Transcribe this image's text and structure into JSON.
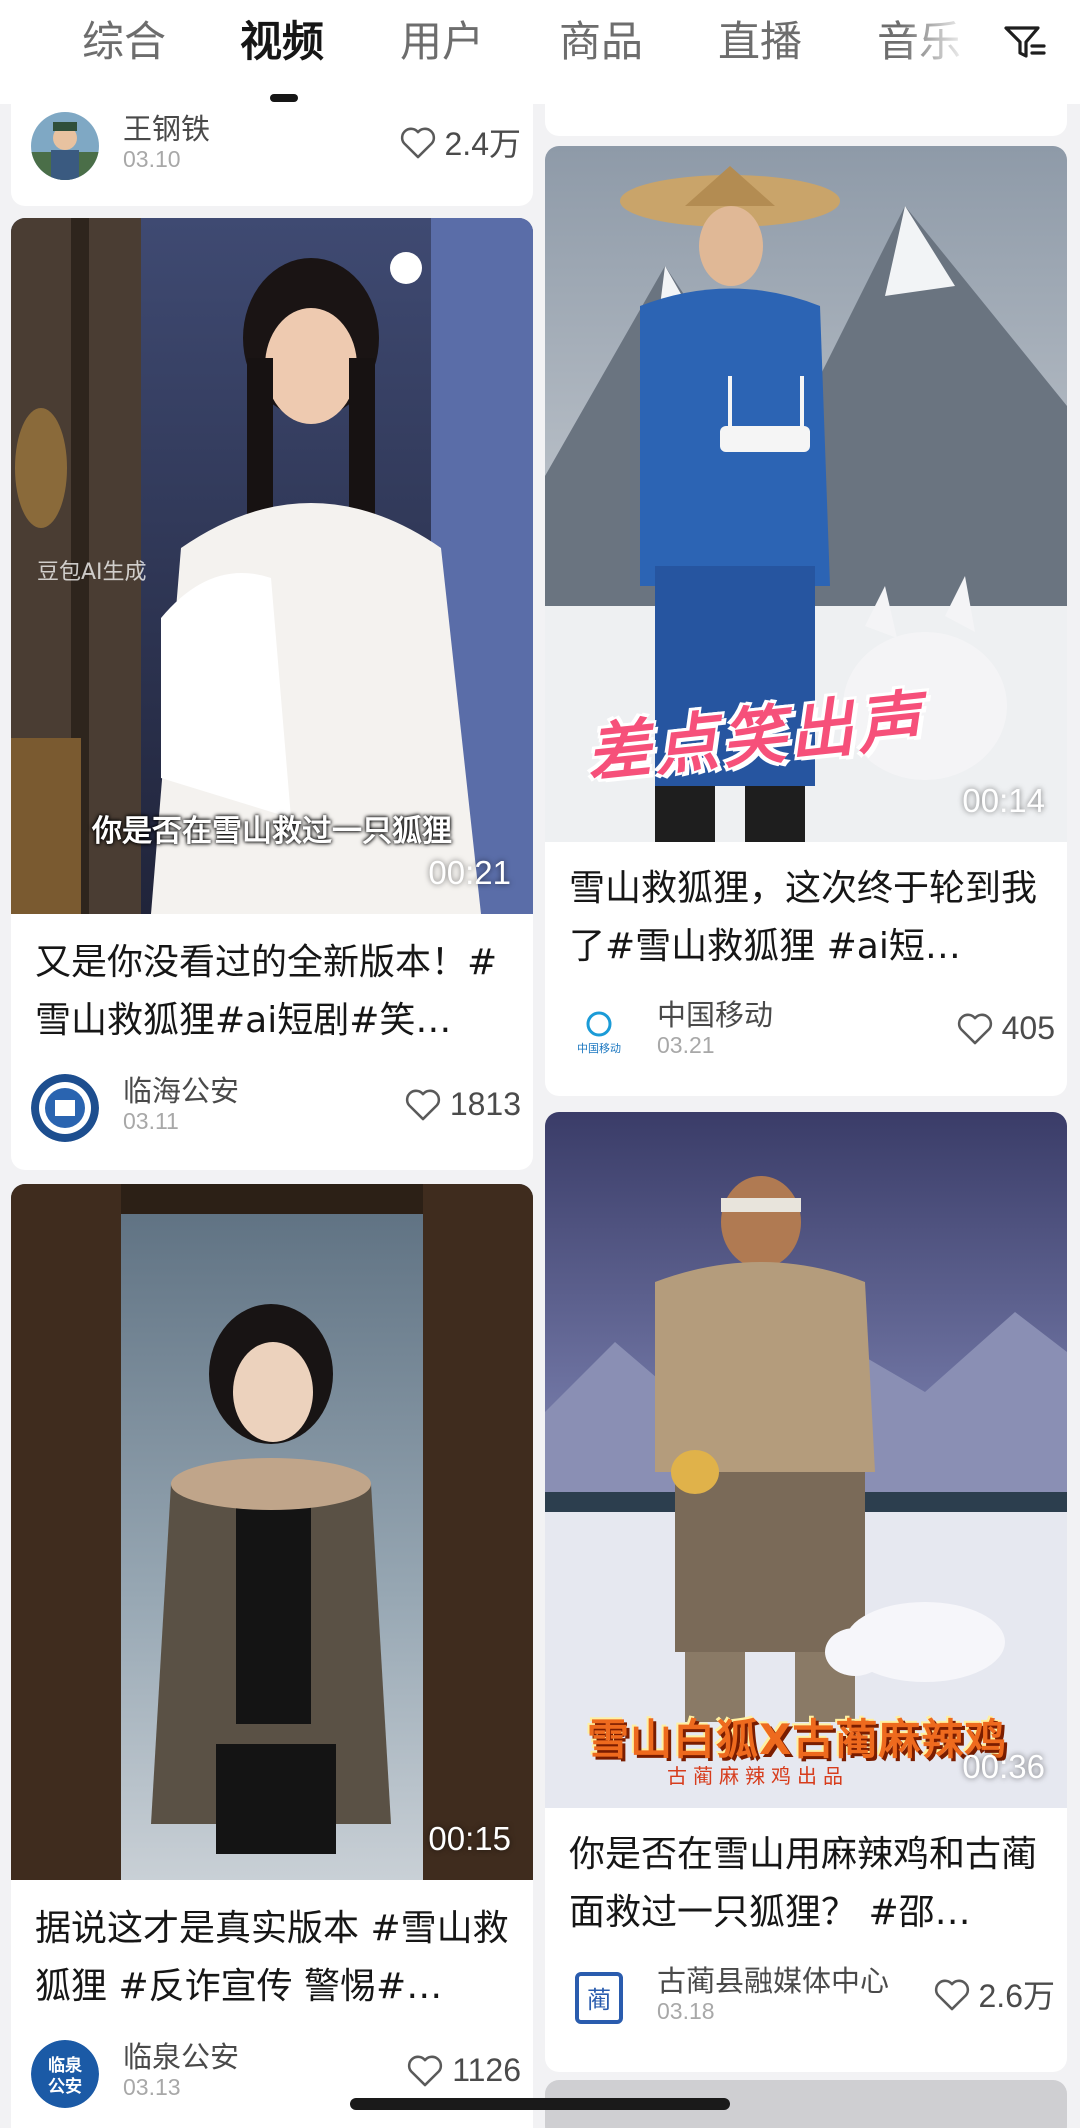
{
  "tabs": [
    "综合",
    "视频",
    "用户",
    "商品",
    "直播",
    "音乐"
  ],
  "active_tab": "视频",
  "filter_icon": "filter-icon",
  "cards": [
    {
      "author": "王钢铁",
      "date": "03.10",
      "likes": "2.4万"
    },
    {
      "title": "又是你没看过的全新版本！#雪山救狐狸#ai短剧#笑…",
      "caption": "你是否在雪山救过一只狐狸",
      "watermark": "豆包AI生成",
      "duration": "00:21",
      "author": "临海公安",
      "date": "03.11",
      "likes": "1813"
    },
    {
      "title": "据说这才是真实版本 #雪山救狐狸 #反诈宣传 警惕#…",
      "duration": "00:15",
      "author": "临泉公安",
      "avatar_text": "临泉公安",
      "date": "03.13",
      "likes": "1126"
    },
    {
      "title": "雪山救狐狸，这次终于轮到我了#雪山救狐狸 #ai短…",
      "caption": "差点笑出声",
      "duration": "00:14",
      "author": "中国移动",
      "avatar_text": "中国移动",
      "date": "03.21",
      "likes": "405"
    },
    {
      "title": "你是否在雪山用麻辣鸡和古蔺面救过一只狐狸？ #邵…",
      "caption": "雪山白狐X古蔺麻辣鸡",
      "subcaption": "古蔺麻辣鸡出品",
      "duration": "00:36",
      "author": "古蔺县融媒体中心",
      "avatar_text": "蔺",
      "date": "03.18",
      "likes": "2.6万"
    }
  ],
  "colors": {
    "background": "#f2f2f4",
    "card": "#ffffff",
    "active_tab": "#161616",
    "inactive_tab": "#6d6d6d"
  }
}
